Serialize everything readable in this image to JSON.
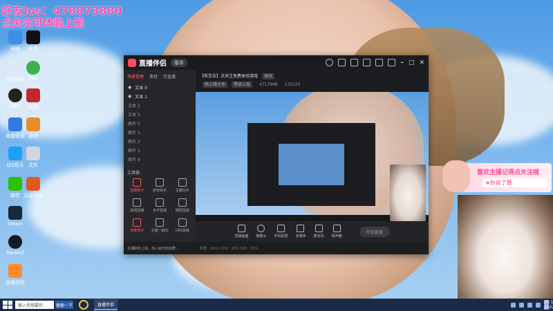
{
  "overlay": {
    "line1": "好友Ios：478873880",
    "line2": "点关注可体验上船"
  },
  "desktop_icons": [
    "网络",
    "手游",
    "控制面板",
    "360",
    "OBS",
    "迅游",
    "电脑管家",
    "游戏",
    "QQ音乐",
    "文件",
    "微信",
    "迅游加速",
    "Steam",
    "Steam2",
    "直播伴侣"
  ],
  "app": {
    "name": "直播伴侣",
    "version_pill": "版本",
    "left_tabs": [
      "场景管理",
      "素材",
      "可直播"
    ],
    "scenes": [
      "文本 0",
      "文本 1",
      "文本 2",
      "文本 3",
      "图片 0",
      "图片 1",
      "图片 2",
      "图片 3",
      "图片 4"
    ],
    "tools_title": "工具箱",
    "tools": [
      "直播助手",
      "房管助手",
      "主播任务",
      "视频直播",
      "多开直播",
      "横屏直播",
      "连麦助手",
      "主播一起玩",
      "OBS直播"
    ],
    "bottom_notice": "主播助手上线，加入官方粉丝群…",
    "room": {
      "title": "【有车位】点关注免费体验游戏",
      "pill": "修改",
      "sub1": "晚上跳大杀",
      "sub2": "等级上船",
      "stat1": "4717998",
      "stat2": "125120"
    },
    "bottom_tools": [
      "直播画面",
      "摄像头",
      "手机投屏",
      "多媒体",
      "麦克风",
      "扬声器"
    ],
    "start_live": "开始直播",
    "status": "带宽：0kb/s   CPU：30%   内存：70%"
  },
  "stream_overlay": {
    "banner_line1": "喜欢主播记得点关注哦",
    "banner_line2": "≡你说了算"
  },
  "taskbar": {
    "search_placeholder": "输入你想要的",
    "search_button": "搜索一下",
    "app_label": "直播伴侣",
    "time": "20:13:43",
    "date": "2022/7/4"
  }
}
